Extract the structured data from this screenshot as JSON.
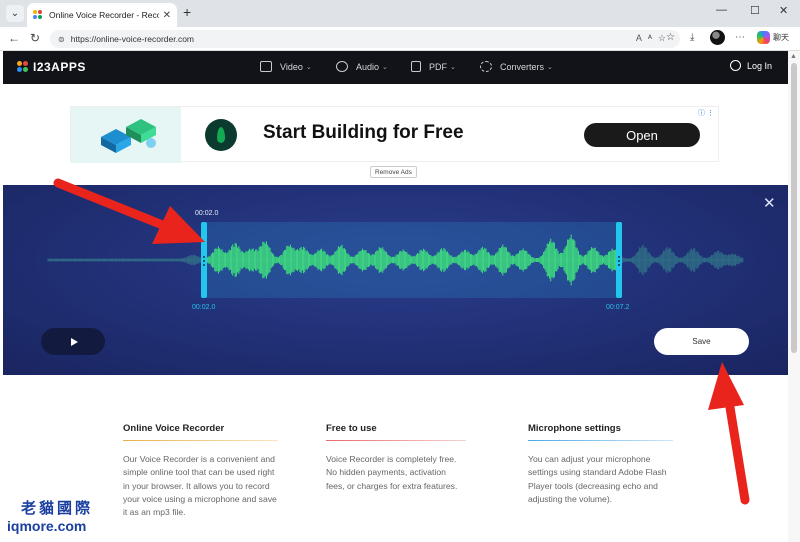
{
  "browser": {
    "tab_title": "Online Voice Recorder - Record Vo",
    "tab_close": "✕",
    "new_tab": "+",
    "url": "https://online-voice-recorder.com",
    "copilot_label": "聊天",
    "window_controls": [
      "—",
      "☐",
      "✕"
    ]
  },
  "site": {
    "logo_text": "I23APPS",
    "menu": [
      {
        "label": "Video"
      },
      {
        "label": "Audio"
      },
      {
        "label": "PDF"
      },
      {
        "label": "Converters"
      }
    ],
    "login_label": "Log In"
  },
  "ad": {
    "headline": "Start Building for Free",
    "cta": "Open",
    "remove_ads": "Remove Ads"
  },
  "recorder": {
    "close_label": "✕",
    "top_time": "00:02.0",
    "start_time": "00:02.0",
    "end_time": "00:07.2",
    "save_label": "Save",
    "colors": {
      "wave": "#3ee07e",
      "wave_dim": "#2f6d86",
      "handle": "#22c7ee",
      "time": "#29bfe8"
    }
  },
  "info": [
    {
      "title": "Online Voice Recorder",
      "text": "Our Voice Recorder is a convenient and simple online tool that can be used right in your browser. It allows you to record your voice using a microphone and save it as an mp3 file.",
      "accent": "#e8b04a"
    },
    {
      "title": "Free to use",
      "text": "Voice Recorder is completely free. No hidden payments, activation fees, or charges for extra features.",
      "accent": "#e86a6a"
    },
    {
      "title": "Microphone settings",
      "text": "You can adjust your microphone settings using standard Adobe Flash Player tools (decreasing echo and adjusting the volume).",
      "accent": "#4aa8e8"
    }
  ],
  "watermark": {
    "line1": "老貓國際",
    "line2": "iqmore.com"
  }
}
